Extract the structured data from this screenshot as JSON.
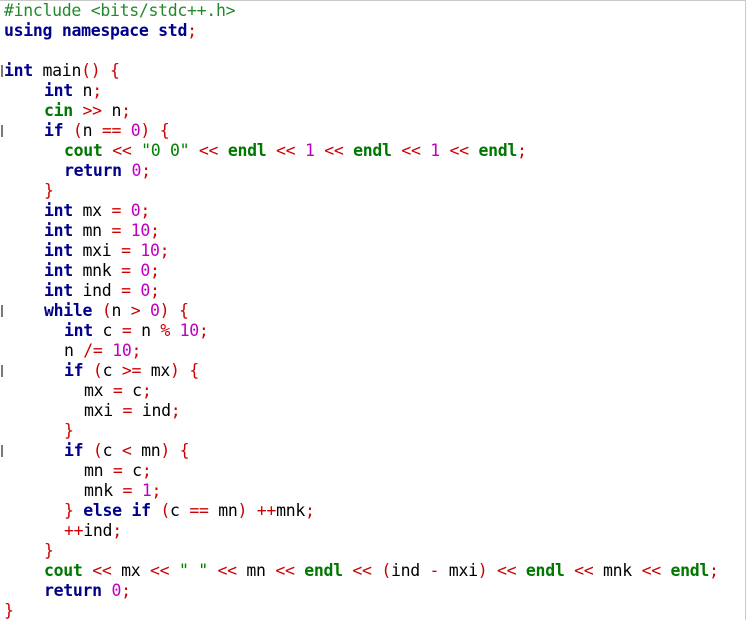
{
  "lines": [
    {
      "indent": 0,
      "fold": false,
      "tokens": [
        {
          "t": "#include <bits/stdc++.h>",
          "k": "pp"
        }
      ]
    },
    {
      "indent": 0,
      "fold": false,
      "tokens": [
        {
          "t": "using",
          "k": "kw"
        },
        {
          "t": " ",
          "k": "id"
        },
        {
          "t": "namespace",
          "k": "kw"
        },
        {
          "t": " ",
          "k": "id"
        },
        {
          "t": "std",
          "k": "kw"
        },
        {
          "t": ";",
          "k": "op"
        }
      ]
    },
    {
      "indent": 0,
      "fold": false,
      "tokens": []
    },
    {
      "indent": 0,
      "fold": true,
      "tokens": [
        {
          "t": "int",
          "k": "ty"
        },
        {
          "t": " main",
          "k": "id"
        },
        {
          "t": "()",
          "k": "op"
        },
        {
          "t": " ",
          "k": "id"
        },
        {
          "t": "{",
          "k": "op"
        }
      ]
    },
    {
      "indent": 4,
      "fold": false,
      "tokens": [
        {
          "t": "int",
          "k": "ty"
        },
        {
          "t": " n",
          "k": "id"
        },
        {
          "t": ";",
          "k": "op"
        }
      ]
    },
    {
      "indent": 4,
      "fold": false,
      "tokens": [
        {
          "t": "cin",
          "k": "lib"
        },
        {
          "t": " ",
          "k": "id"
        },
        {
          "t": ">>",
          "k": "op"
        },
        {
          "t": " n",
          "k": "id"
        },
        {
          "t": ";",
          "k": "op"
        }
      ]
    },
    {
      "indent": 4,
      "fold": true,
      "tokens": [
        {
          "t": "if",
          "k": "kw"
        },
        {
          "t": " ",
          "k": "id"
        },
        {
          "t": "(",
          "k": "op"
        },
        {
          "t": "n ",
          "k": "id"
        },
        {
          "t": "==",
          "k": "op"
        },
        {
          "t": " ",
          "k": "id"
        },
        {
          "t": "0",
          "k": "num"
        },
        {
          "t": ")",
          "k": "op"
        },
        {
          "t": " ",
          "k": "id"
        },
        {
          "t": "{",
          "k": "op"
        }
      ]
    },
    {
      "indent": 6,
      "fold": false,
      "tokens": [
        {
          "t": "cout",
          "k": "lib"
        },
        {
          "t": " ",
          "k": "id"
        },
        {
          "t": "<<",
          "k": "op"
        },
        {
          "t": " ",
          "k": "id"
        },
        {
          "t": "\"0 0\"",
          "k": "str"
        },
        {
          "t": " ",
          "k": "id"
        },
        {
          "t": "<<",
          "k": "op"
        },
        {
          "t": " ",
          "k": "id"
        },
        {
          "t": "endl",
          "k": "lib"
        },
        {
          "t": " ",
          "k": "id"
        },
        {
          "t": "<<",
          "k": "op"
        },
        {
          "t": " ",
          "k": "id"
        },
        {
          "t": "1",
          "k": "num"
        },
        {
          "t": " ",
          "k": "id"
        },
        {
          "t": "<<",
          "k": "op"
        },
        {
          "t": " ",
          "k": "id"
        },
        {
          "t": "endl",
          "k": "lib"
        },
        {
          "t": " ",
          "k": "id"
        },
        {
          "t": "<<",
          "k": "op"
        },
        {
          "t": " ",
          "k": "id"
        },
        {
          "t": "1",
          "k": "num"
        },
        {
          "t": " ",
          "k": "id"
        },
        {
          "t": "<<",
          "k": "op"
        },
        {
          "t": " ",
          "k": "id"
        },
        {
          "t": "endl",
          "k": "lib"
        },
        {
          "t": ";",
          "k": "op"
        }
      ]
    },
    {
      "indent": 6,
      "fold": false,
      "tokens": [
        {
          "t": "return",
          "k": "kw"
        },
        {
          "t": " ",
          "k": "id"
        },
        {
          "t": "0",
          "k": "num"
        },
        {
          "t": ";",
          "k": "op"
        }
      ]
    },
    {
      "indent": 4,
      "fold": false,
      "tokens": [
        {
          "t": "}",
          "k": "op"
        }
      ]
    },
    {
      "indent": 4,
      "fold": false,
      "tokens": [
        {
          "t": "int",
          "k": "ty"
        },
        {
          "t": " mx ",
          "k": "id"
        },
        {
          "t": "=",
          "k": "op"
        },
        {
          "t": " ",
          "k": "id"
        },
        {
          "t": "0",
          "k": "num"
        },
        {
          "t": ";",
          "k": "op"
        }
      ]
    },
    {
      "indent": 4,
      "fold": false,
      "tokens": [
        {
          "t": "int",
          "k": "ty"
        },
        {
          "t": " mn ",
          "k": "id"
        },
        {
          "t": "=",
          "k": "op"
        },
        {
          "t": " ",
          "k": "id"
        },
        {
          "t": "10",
          "k": "num"
        },
        {
          "t": ";",
          "k": "op"
        }
      ]
    },
    {
      "indent": 4,
      "fold": false,
      "tokens": [
        {
          "t": "int",
          "k": "ty"
        },
        {
          "t": " mxi ",
          "k": "id"
        },
        {
          "t": "=",
          "k": "op"
        },
        {
          "t": " ",
          "k": "id"
        },
        {
          "t": "10",
          "k": "num"
        },
        {
          "t": ";",
          "k": "op"
        }
      ]
    },
    {
      "indent": 4,
      "fold": false,
      "tokens": [
        {
          "t": "int",
          "k": "ty"
        },
        {
          "t": " mnk ",
          "k": "id"
        },
        {
          "t": "=",
          "k": "op"
        },
        {
          "t": " ",
          "k": "id"
        },
        {
          "t": "0",
          "k": "num"
        },
        {
          "t": ";",
          "k": "op"
        }
      ]
    },
    {
      "indent": 4,
      "fold": false,
      "tokens": [
        {
          "t": "int",
          "k": "ty"
        },
        {
          "t": " ind ",
          "k": "id"
        },
        {
          "t": "=",
          "k": "op"
        },
        {
          "t": " ",
          "k": "id"
        },
        {
          "t": "0",
          "k": "num"
        },
        {
          "t": ";",
          "k": "op"
        }
      ]
    },
    {
      "indent": 4,
      "fold": true,
      "tokens": [
        {
          "t": "while",
          "k": "kw"
        },
        {
          "t": " ",
          "k": "id"
        },
        {
          "t": "(",
          "k": "op"
        },
        {
          "t": "n ",
          "k": "id"
        },
        {
          "t": ">",
          "k": "op"
        },
        {
          "t": " ",
          "k": "id"
        },
        {
          "t": "0",
          "k": "num"
        },
        {
          "t": ")",
          "k": "op"
        },
        {
          "t": " ",
          "k": "id"
        },
        {
          "t": "{",
          "k": "op"
        }
      ]
    },
    {
      "indent": 6,
      "fold": false,
      "tokens": [
        {
          "t": "int",
          "k": "ty"
        },
        {
          "t": " c ",
          "k": "id"
        },
        {
          "t": "=",
          "k": "op"
        },
        {
          "t": " n ",
          "k": "id"
        },
        {
          "t": "%",
          "k": "op"
        },
        {
          "t": " ",
          "k": "id"
        },
        {
          "t": "10",
          "k": "num"
        },
        {
          "t": ";",
          "k": "op"
        }
      ]
    },
    {
      "indent": 6,
      "fold": false,
      "tokens": [
        {
          "t": "n ",
          "k": "id"
        },
        {
          "t": "/=",
          "k": "op"
        },
        {
          "t": " ",
          "k": "id"
        },
        {
          "t": "10",
          "k": "num"
        },
        {
          "t": ";",
          "k": "op"
        }
      ]
    },
    {
      "indent": 6,
      "fold": true,
      "tokens": [
        {
          "t": "if",
          "k": "kw"
        },
        {
          "t": " ",
          "k": "id"
        },
        {
          "t": "(",
          "k": "op"
        },
        {
          "t": "c ",
          "k": "id"
        },
        {
          "t": ">=",
          "k": "op"
        },
        {
          "t": " mx",
          "k": "id"
        },
        {
          "t": ")",
          "k": "op"
        },
        {
          "t": " ",
          "k": "id"
        },
        {
          "t": "{",
          "k": "op"
        }
      ]
    },
    {
      "indent": 8,
      "fold": false,
      "tokens": [
        {
          "t": "mx ",
          "k": "id"
        },
        {
          "t": "=",
          "k": "op"
        },
        {
          "t": " c",
          "k": "id"
        },
        {
          "t": ";",
          "k": "op"
        }
      ]
    },
    {
      "indent": 8,
      "fold": false,
      "tokens": [
        {
          "t": "mxi ",
          "k": "id"
        },
        {
          "t": "=",
          "k": "op"
        },
        {
          "t": " ind",
          "k": "id"
        },
        {
          "t": ";",
          "k": "op"
        }
      ]
    },
    {
      "indent": 6,
      "fold": false,
      "tokens": [
        {
          "t": "}",
          "k": "op"
        }
      ]
    },
    {
      "indent": 6,
      "fold": true,
      "tokens": [
        {
          "t": "if",
          "k": "kw"
        },
        {
          "t": " ",
          "k": "id"
        },
        {
          "t": "(",
          "k": "op"
        },
        {
          "t": "c ",
          "k": "id"
        },
        {
          "t": "<",
          "k": "op"
        },
        {
          "t": " mn",
          "k": "id"
        },
        {
          "t": ")",
          "k": "op"
        },
        {
          "t": " ",
          "k": "id"
        },
        {
          "t": "{",
          "k": "op"
        }
      ]
    },
    {
      "indent": 8,
      "fold": false,
      "tokens": [
        {
          "t": "mn ",
          "k": "id"
        },
        {
          "t": "=",
          "k": "op"
        },
        {
          "t": " c",
          "k": "id"
        },
        {
          "t": ";",
          "k": "op"
        }
      ]
    },
    {
      "indent": 8,
      "fold": false,
      "tokens": [
        {
          "t": "mnk ",
          "k": "id"
        },
        {
          "t": "=",
          "k": "op"
        },
        {
          "t": " ",
          "k": "id"
        },
        {
          "t": "1",
          "k": "num"
        },
        {
          "t": ";",
          "k": "op"
        }
      ]
    },
    {
      "indent": 6,
      "fold": false,
      "tokens": [
        {
          "t": "}",
          "k": "op"
        },
        {
          "t": " ",
          "k": "id"
        },
        {
          "t": "else",
          "k": "kw"
        },
        {
          "t": " ",
          "k": "id"
        },
        {
          "t": "if",
          "k": "kw"
        },
        {
          "t": " ",
          "k": "id"
        },
        {
          "t": "(",
          "k": "op"
        },
        {
          "t": "c ",
          "k": "id"
        },
        {
          "t": "==",
          "k": "op"
        },
        {
          "t": " mn",
          "k": "id"
        },
        {
          "t": ")",
          "k": "op"
        },
        {
          "t": " ",
          "k": "id"
        },
        {
          "t": "++",
          "k": "op"
        },
        {
          "t": "mnk",
          "k": "id"
        },
        {
          "t": ";",
          "k": "op"
        }
      ]
    },
    {
      "indent": 6,
      "fold": false,
      "tokens": [
        {
          "t": "++",
          "k": "op"
        },
        {
          "t": "ind",
          "k": "id"
        },
        {
          "t": ";",
          "k": "op"
        }
      ]
    },
    {
      "indent": 4,
      "fold": false,
      "tokens": [
        {
          "t": "}",
          "k": "op"
        }
      ]
    },
    {
      "indent": 4,
      "fold": false,
      "tokens": [
        {
          "t": "cout",
          "k": "lib"
        },
        {
          "t": " ",
          "k": "id"
        },
        {
          "t": "<<",
          "k": "op"
        },
        {
          "t": " mx ",
          "k": "id"
        },
        {
          "t": "<<",
          "k": "op"
        },
        {
          "t": " ",
          "k": "id"
        },
        {
          "t": "\" \"",
          "k": "str"
        },
        {
          "t": " ",
          "k": "id"
        },
        {
          "t": "<<",
          "k": "op"
        },
        {
          "t": " mn ",
          "k": "id"
        },
        {
          "t": "<<",
          "k": "op"
        },
        {
          "t": " ",
          "k": "id"
        },
        {
          "t": "endl",
          "k": "lib"
        },
        {
          "t": " ",
          "k": "id"
        },
        {
          "t": "<<",
          "k": "op"
        },
        {
          "t": " ",
          "k": "id"
        },
        {
          "t": "(",
          "k": "op"
        },
        {
          "t": "ind ",
          "k": "id"
        },
        {
          "t": "-",
          "k": "op"
        },
        {
          "t": " mxi",
          "k": "id"
        },
        {
          "t": ")",
          "k": "op"
        },
        {
          "t": " ",
          "k": "id"
        },
        {
          "t": "<<",
          "k": "op"
        },
        {
          "t": " ",
          "k": "id"
        },
        {
          "t": "endl",
          "k": "lib"
        },
        {
          "t": " ",
          "k": "id"
        },
        {
          "t": "<<",
          "k": "op"
        },
        {
          "t": " mnk ",
          "k": "id"
        },
        {
          "t": "<<",
          "k": "op"
        },
        {
          "t": " ",
          "k": "id"
        },
        {
          "t": "endl",
          "k": "lib"
        },
        {
          "t": ";",
          "k": "op"
        }
      ]
    },
    {
      "indent": 4,
      "fold": false,
      "tokens": [
        {
          "t": "return",
          "k": "kw"
        },
        {
          "t": " ",
          "k": "id"
        },
        {
          "t": "0",
          "k": "num"
        },
        {
          "t": ";",
          "k": "op"
        }
      ]
    },
    {
      "indent": 0,
      "fold": false,
      "tokens": [
        {
          "t": "}",
          "k": "op"
        }
      ]
    }
  ],
  "colors": {
    "preprocessor": "#218a2b",
    "keyword": "#00008b",
    "library": "#007700",
    "operator": "#cc0000",
    "number": "#c000c0",
    "string": "#008000",
    "identifier": "#000000",
    "background": "#ffffff"
  }
}
